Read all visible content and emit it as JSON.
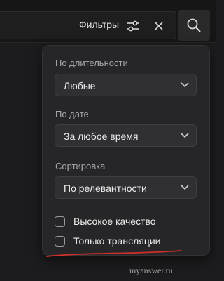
{
  "toolbar": {
    "filters_label": "Фильтры",
    "filters_icon": "sliders-icon",
    "clear_icon": "close-icon",
    "search_icon": "magnifier-icon"
  },
  "filters_panel": {
    "duration": {
      "label": "По длительности",
      "value": "Любые"
    },
    "date": {
      "label": "По дате",
      "value": "За любое время"
    },
    "sort": {
      "label": "Сортировка",
      "value": "По релевантности"
    },
    "options": [
      {
        "label": "Высокое качество",
        "checked": false
      },
      {
        "label": "Только трансляции",
        "checked": false
      }
    ]
  },
  "annotation": {
    "underline_color": "#d0302a"
  },
  "watermark": "myanswer.ru",
  "colors": {
    "background": "#1c1c1e",
    "panel": "#262628",
    "select": "#303033",
    "text": "#ededed",
    "muted": "#a9a9ad"
  }
}
